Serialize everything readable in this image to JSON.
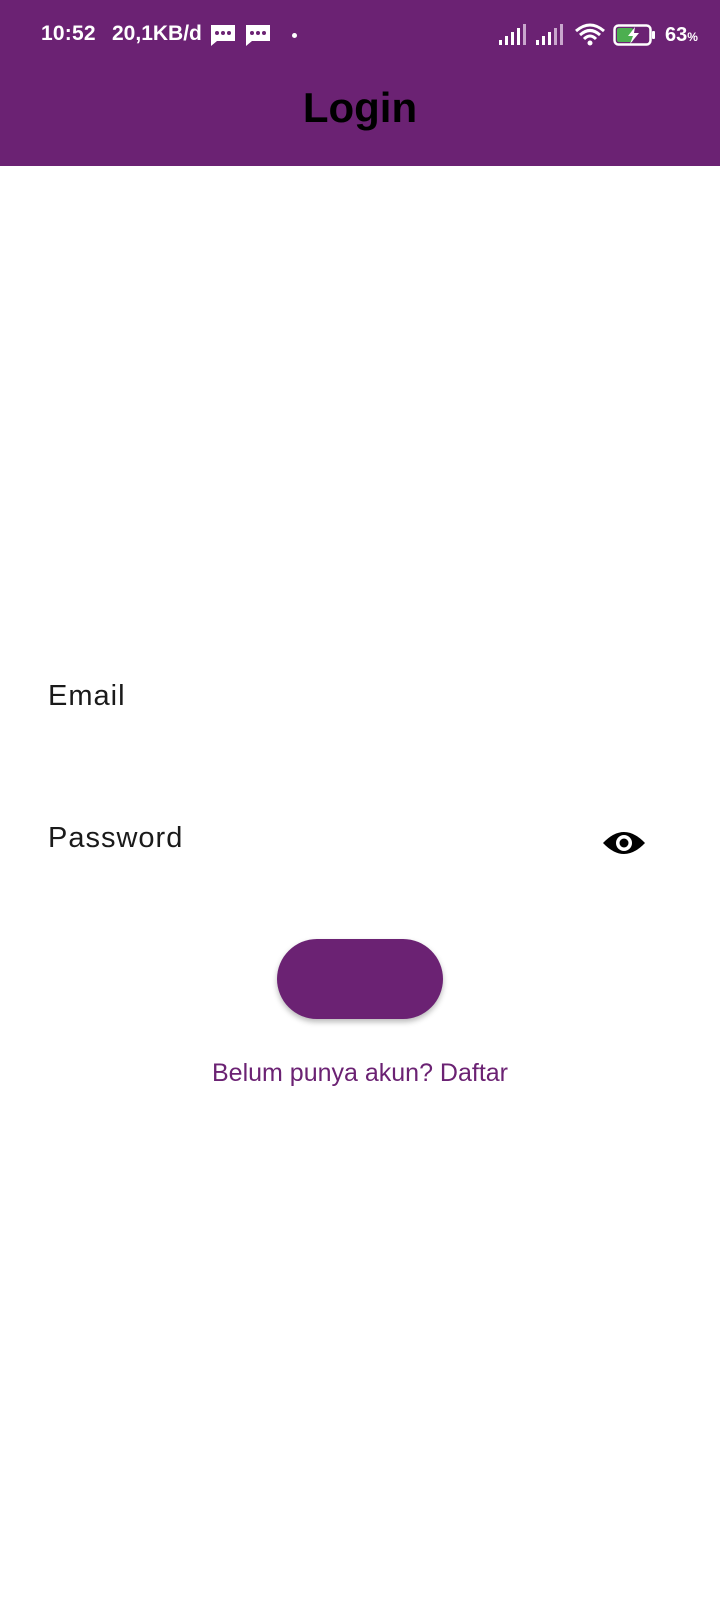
{
  "status_bar": {
    "time": "10:52",
    "network_speed": "20,1KB/d",
    "notification_icons": [
      "message-icon",
      "message-icon"
    ],
    "signal_icons": [
      "signal-icon",
      "signal-icon"
    ],
    "wifi_icon": "wifi-icon",
    "battery_icon": "battery-charging-icon",
    "battery_percent": "63",
    "battery_unit": "%"
  },
  "app_bar": {
    "title": "Login"
  },
  "form": {
    "email_label": "Email",
    "password_label": "Password",
    "password_toggle_icon": "eye-icon",
    "login_button_label": "",
    "register_link": "Belum punya akun? Daftar"
  },
  "colors": {
    "primary": "#6b2273",
    "background": "#ffffff",
    "text": "#1a1a1a"
  }
}
